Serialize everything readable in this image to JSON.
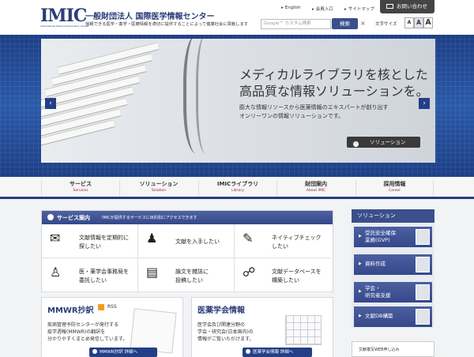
{
  "header": {
    "logo_mark": "IMIC",
    "logo_sub": "International Medical Information Center",
    "org_name": "一般財団法人 国際医学情報センター",
    "org_tagline": "信頼できる医学・薬学・医療情報を適切に提供することによって健康社会に貢献します",
    "util_links": [
      "English",
      "会員入口",
      "サイトマップ"
    ],
    "contact_label": "お問い合わせ",
    "search_placeholder": "Google™ カスタム検索",
    "search_button": "検索",
    "search_clear": "×",
    "font_size_label": "文字サイズ",
    "font_sizes": [
      "A",
      "A",
      "A"
    ]
  },
  "hero": {
    "title_line1": "メディカルライブラリを核とした",
    "title_line2": "高品質な情報ソリューションを。",
    "desc_line1": "膨大な情報リソースから医薬情報のエキスパートが創り出す",
    "desc_line2": "オンリーワンの情報ソリューションです。",
    "button_label": "ソリューション",
    "prev_arrow": "‹",
    "next_arrow": "›",
    "slide_count": 4,
    "active_slide": 1
  },
  "nav": {
    "items": [
      {
        "jp": "サービス",
        "en": "Services"
      },
      {
        "jp": "ソリューション",
        "en": "Solution"
      },
      {
        "jp": "IMICライブラリ",
        "en": "Library"
      },
      {
        "jp": "財団案内",
        "en": "About IMIC"
      },
      {
        "jp": "採用情報",
        "en": "Career"
      }
    ]
  },
  "services": {
    "title": "サービス案内",
    "description": "IMICが提供するサービスに目的別にアクセスできます",
    "items": [
      {
        "icon": "mail-arrow-icon",
        "glyph": "✉",
        "line1": "文献情報を定期的に",
        "line2": "探したい"
      },
      {
        "icon": "person-reading-icon",
        "glyph": "♟",
        "line1": "文献を入手したい",
        "line2": ""
      },
      {
        "icon": "pen-check-icon",
        "glyph": "✎",
        "line1": "ネイティブチェック",
        "line2": "したい"
      },
      {
        "icon": "lectern-icon",
        "glyph": "♙",
        "line1": "医・薬学会事務局を",
        "line2": "委託したい"
      },
      {
        "icon": "clipboard-icon",
        "glyph": "▤",
        "line1": "論文を雑誌に",
        "line2": "投稿したい"
      },
      {
        "icon": "database-hands-icon",
        "glyph": "☍",
        "line1": "文献データベースを",
        "line2": "構築したい"
      }
    ]
  },
  "cards": [
    {
      "title": "MMWR抄訳",
      "rss": "RSS",
      "lines": [
        "疾病管理予防センターが発行する",
        "疫学週報(MMWR)の翻訳を",
        "分かりやすくまとめ発信しています。"
      ],
      "button": "MMWR抄訳 詳細へ"
    },
    {
      "title": "医薬学会情報",
      "lines": [
        "医学会及び関連分野の",
        "学会・研究会(日本国内)の",
        "情報がご覧いただけます。"
      ],
      "button": "医薬学会情報 詳細へ"
    }
  ],
  "solutions": {
    "title": "ソリューション",
    "items": [
      {
        "line1": "受託安全確保",
        "line2": "業務(GVP)"
      },
      {
        "line1": "資料作成",
        "line2": ""
      },
      {
        "line1": "学会・",
        "line2": "研究者支援"
      },
      {
        "line1": "文献DB構築",
        "line2": ""
      }
    ],
    "banner": "文献複写WEB申し込み"
  }
}
